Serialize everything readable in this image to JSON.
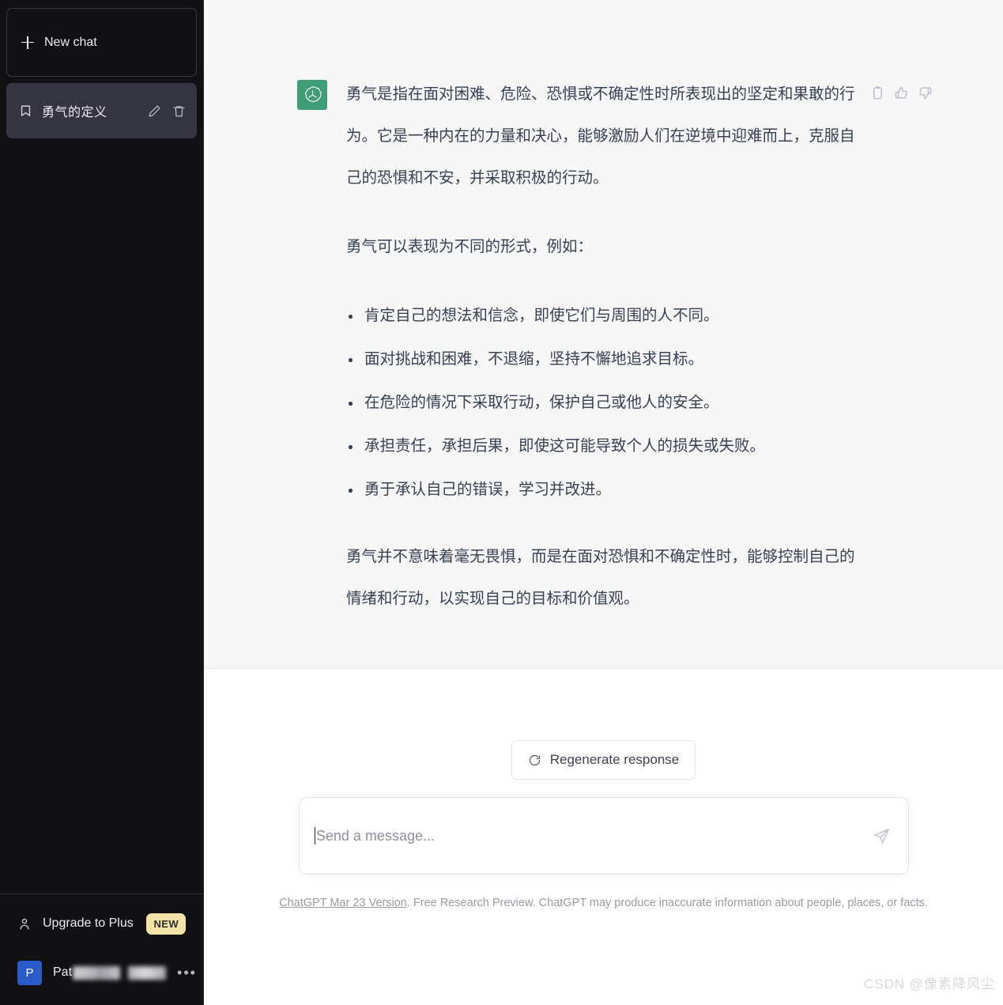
{
  "sidebar": {
    "new_chat": {
      "label": "New chat",
      "icon": "plus-icon"
    },
    "chats": [
      {
        "title": "勇气的定义",
        "icon": "message-square-icon",
        "edit_icon": "pencil-icon",
        "delete_icon": "trash-icon",
        "active": true
      }
    ],
    "upgrade": {
      "label": "Upgrade to Plus",
      "badge": "NEW",
      "icon": "user-outline-icon"
    },
    "user": {
      "avatar_letter": "P",
      "name_visible": "Pat",
      "name_redacted": true,
      "menu_icon": "ellipsis-icon"
    },
    "colors": {
      "background": "#111114",
      "active_item": "#353541",
      "badge": "#f4e4a8",
      "avatar": "#2a5bc8"
    }
  },
  "conversation": {
    "avatar": {
      "name": "openai-logo",
      "color": "#3f9e78"
    },
    "actions": [
      {
        "name": "copy-icon",
        "label": "Copy"
      },
      {
        "name": "thumbs-up-icon",
        "label": "Good response"
      },
      {
        "name": "thumbs-down-icon",
        "label": "Bad response"
      }
    ],
    "message": {
      "paragraph_1": "勇气是指在面对困难、危险、恐惧或不确定性时所表现出的坚定和果敢的行为。它是一种内在的力量和决心，能够激励人们在逆境中迎难而上，克服自己的恐惧和不安，并采取积极的行动。",
      "paragraph_2": "勇气可以表现为不同的形式，例如：",
      "bullets": [
        "肯定自己的想法和信念，即使它们与周围的人不同。",
        "面对挑战和困难，不退缩，坚持不懈地追求目标。",
        "在危险的情况下采取行动，保护自己或他人的安全。",
        "承担责任，承担后果，即使这可能导致个人的损失或失败。",
        "勇于承认自己的错误，学习并改进。"
      ],
      "paragraph_3": "勇气并不意味着毫无畏惧，而是在面对恐惧和不确定性时，能够控制自己的情绪和行动，以实现自己的目标和价值观。"
    }
  },
  "composer": {
    "regenerate_label": "Regenerate response",
    "regenerate_icon": "refresh-icon",
    "placeholder": "Send a message...",
    "value": "",
    "send_icon": "send-plane-icon"
  },
  "footer": {
    "link_text": "ChatGPT Mar 23 Version",
    "rest_text": ". Free Research Preview. ChatGPT may produce inaccurate information about people, places, or facts."
  },
  "watermark": {
    "text": "CSDN @像素降风尘"
  }
}
